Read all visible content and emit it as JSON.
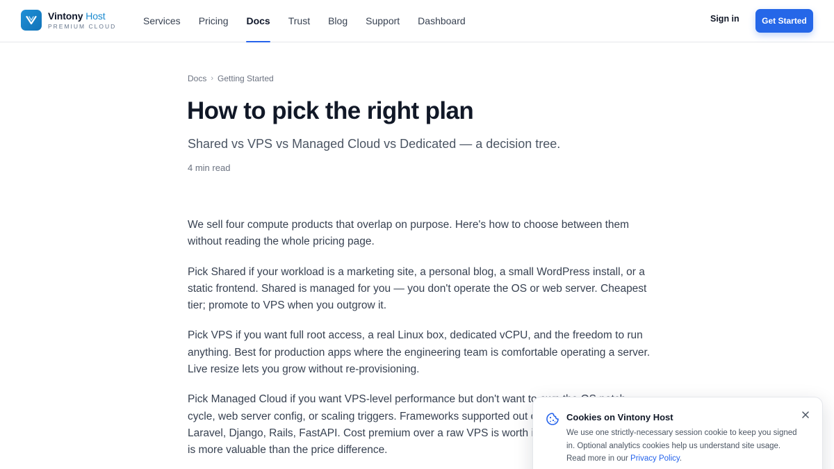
{
  "brand": {
    "name": "Vintony",
    "name_accent": "Host",
    "tagline": "PREMIUM CLOUD"
  },
  "nav": {
    "items": [
      {
        "label": "Services"
      },
      {
        "label": "Pricing"
      },
      {
        "label": "Docs",
        "active": true
      },
      {
        "label": "Trust"
      },
      {
        "label": "Blog"
      },
      {
        "label": "Support"
      },
      {
        "label": "Dashboard"
      }
    ],
    "sign_in": "Sign in",
    "get_started": "Get Started"
  },
  "breadcrumb": {
    "root": "Docs",
    "current": "Getting Started"
  },
  "article": {
    "title": "How to pick the right plan",
    "subtitle": "Shared vs VPS vs Managed Cloud vs Dedicated — a decision tree.",
    "read_time": "4 min read",
    "paragraphs": [
      "We sell four compute products that overlap on purpose. Here's how to choose between them without reading the whole pricing page.",
      "Pick Shared if your workload is a marketing site, a personal blog, a small WordPress install, or a static frontend. Shared is managed for you — you don't operate the OS or web server. Cheapest tier; promote to VPS when you outgrow it.",
      "Pick VPS if you want full root access, a real Linux box, dedicated vCPU, and the freedom to run anything. Best for production apps where the engineering team is comfortable operating a server. Live resize lets you grow without re-provisioning.",
      "Pick Managed Cloud if you want VPS-level performance but don't want to own the OS patch cycle, web server config, or scaling triggers. Frameworks supported out of the box include Laravel, Django, Rails, FastAPI. Cost premium over a raw VPS is worth it when engineering time is more valuable than the price difference."
    ]
  },
  "cookie_banner": {
    "title": "Cookies on Vintony Host",
    "text": "We use one strictly-necessary session cookie to keep you signed in. Optional analytics cookies help us understand site usage. Read more in our ",
    "link": "Privacy Policy",
    "suffix": "."
  },
  "colors": {
    "accent": "#2567e8",
    "brand": "#1a8ad0",
    "text": "#374151",
    "heading": "#111827"
  }
}
